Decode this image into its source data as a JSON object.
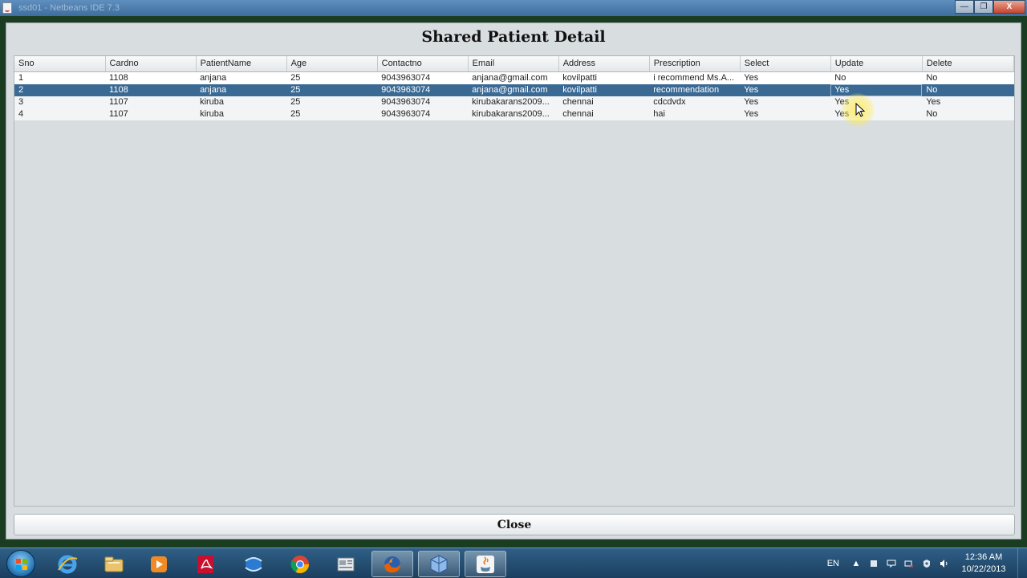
{
  "titlebar": {
    "title": "ssd01 - Netbeans IDE 7.3",
    "buttons": {
      "minimize": "—",
      "maximize": "❐",
      "close": "X"
    }
  },
  "window": {
    "title": "Shared Patient Detail"
  },
  "table": {
    "columns": [
      "Sno",
      "Cardno",
      "PatientName",
      "Age",
      "Contactno",
      "Email",
      "Address",
      "Prescription",
      "Select",
      "Update",
      "Delete"
    ],
    "rows": [
      [
        "1",
        "1108",
        "anjana",
        "25",
        "9043963074",
        "anjana@gmail.com",
        "kovilpatti",
        "i recommend Ms.A...",
        "Yes",
        "No",
        "No"
      ],
      [
        "2",
        "1108",
        "anjana",
        "25",
        "9043963074",
        "anjana@gmail.com",
        "kovilpatti",
        "recommendation",
        "Yes",
        "Yes",
        "No"
      ],
      [
        "3",
        "1107",
        "kiruba",
        "25",
        "9043963074",
        "kirubakarans2009...",
        "chennai",
        "cdcdvdx",
        "Yes",
        "Yes",
        "Yes"
      ],
      [
        "4",
        "1107",
        "kiruba",
        "25",
        "9043963074",
        "kirubakarans2009...",
        "chennai",
        "hai",
        "Yes",
        "Yes",
        "No"
      ]
    ],
    "selected_row": 2
  },
  "close_button": {
    "label": "Close"
  },
  "taskbar": {
    "apps": [
      {
        "name": "internet-explorer-icon",
        "color": "#3a8fd6"
      },
      {
        "name": "file-explorer-icon",
        "color": "#e9c46a"
      },
      {
        "name": "media-player-icon",
        "color": "#f08a24"
      },
      {
        "name": "adobe-reader-icon",
        "color": "#c8102e"
      },
      {
        "name": "network-icon",
        "color": "#2b7bd1"
      },
      {
        "name": "chrome-icon",
        "color": "#34a853"
      },
      {
        "name": "document-viewer-icon",
        "color": "#9aa3ab"
      },
      {
        "name": "firefox-icon",
        "color": "#e66000"
      },
      {
        "name": "virtualbox-icon",
        "color": "#5b8fd0"
      },
      {
        "name": "java-icon",
        "color": "#e76f00"
      }
    ],
    "tray": {
      "language": "EN",
      "time": "12:36 AM",
      "date": "10/22/2013"
    }
  }
}
